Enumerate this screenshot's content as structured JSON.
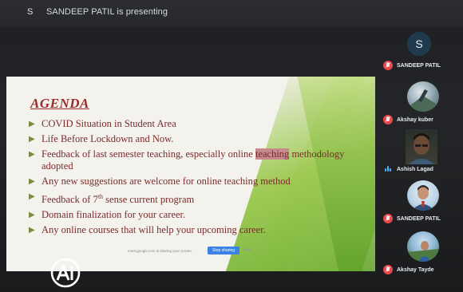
{
  "topbar": {
    "avatar_letter": "S",
    "presenting": "SANDEEP PATIL is presenting"
  },
  "slide": {
    "title": "AGENDA",
    "bullets": [
      {
        "text": "COVID Situation in Student Area"
      },
      {
        "text": "Life Before Lockdown and Now."
      },
      {
        "text_a": "Feedback of last semester teaching, especially online ",
        "highlight": "teaching",
        "text_b": " methodology adopted"
      },
      {
        "text": "Any new suggestions are welcome for online teaching method"
      },
      {
        "text_a": "Feedback of 7",
        "sup": "th",
        "text_b": " sense current program"
      },
      {
        "text": "Domain finalization for your career."
      },
      {
        "text": "Any online courses that will help your upcoming career."
      }
    ],
    "share_bar": {
      "text": "meet.google.com is sharing your screen.",
      "stop_label": "Stop sharing",
      "hide_label": "Hide"
    }
  },
  "participants": {
    "main_avatar_letter": "S",
    "list": [
      {
        "name": "SANDEEP PATIL",
        "muted": true,
        "avatar": "none"
      },
      {
        "name": "Akshay kuber",
        "muted": true,
        "avatar": "round-landscape"
      },
      {
        "name": "Ashish Lagad",
        "muted": false,
        "avatar": "video"
      },
      {
        "name": "SANDEEP PATIL",
        "muted": true,
        "avatar": "round-person"
      },
      {
        "name": "Akshay Tayde",
        "muted": true,
        "avatar": "round-outdoor"
      }
    ]
  },
  "colors": {
    "title": "#9b2a2a",
    "bullet_text": "#7a2b2b",
    "bullet_mark": "#7a8a3e",
    "mic_muted": "#e5484d",
    "speaking": "#46b6ff",
    "accent_green": "#6aaa2d"
  },
  "watermark": {
    "text": "AI"
  }
}
